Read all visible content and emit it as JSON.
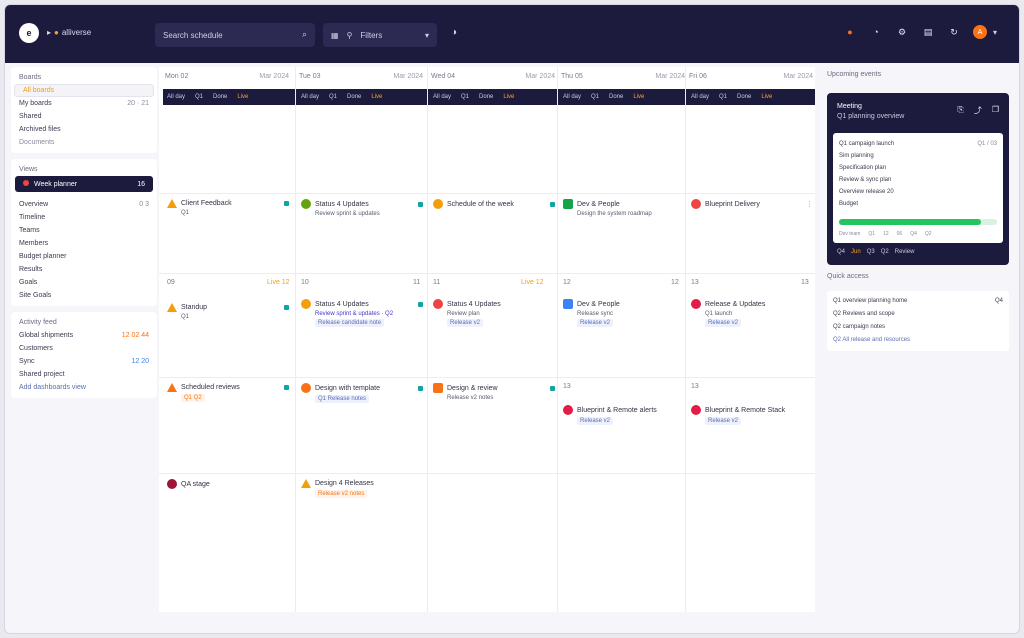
{
  "header": {
    "logo": "e",
    "brand": "alliverse",
    "search": {
      "text": "Search schedule"
    },
    "filter": {
      "label": "Filters"
    },
    "help_icon": "help-icon",
    "avatar": "A"
  },
  "sidebar": {
    "section1_title": "Boards",
    "items1": [
      {
        "label": "All boards",
        "count": ""
      },
      {
        "label": "My boards",
        "count": "20 · 21"
      },
      {
        "label": "Shared",
        "count": ""
      },
      {
        "label": "Archived files",
        "count": ""
      },
      {
        "label": "Documents",
        "count": ""
      }
    ],
    "section2_title": "Views",
    "active_item": {
      "label": "Week planner",
      "count": "16"
    },
    "items2": [
      {
        "label": "Overview",
        "count": "0 3"
      },
      {
        "label": "Timeline",
        "count": ""
      },
      {
        "label": "Teams",
        "count": ""
      },
      {
        "label": "Members",
        "count": ""
      },
      {
        "label": "Budget planner",
        "count": ""
      },
      {
        "label": "Results",
        "count": ""
      },
      {
        "label": "Goals",
        "count": ""
      },
      {
        "label": "Site Goals",
        "count": ""
      }
    ],
    "section3_title": "Activity feed",
    "items3": [
      {
        "label": "Global shipments",
        "count": "12 02 44"
      },
      {
        "label": "Customers",
        "count": ""
      },
      {
        "label": "Sync",
        "count": "12 20"
      },
      {
        "label": "Shared project",
        "count": ""
      },
      {
        "label": "Add dashboards view",
        "count": ""
      }
    ]
  },
  "calendar": {
    "columns": [
      {
        "title": "Mon 02",
        "sub": "Mar 2024"
      },
      {
        "title": "Tue 03",
        "sub": "Mar 2024"
      },
      {
        "title": "Wed 04",
        "sub": "Mar 2024"
      },
      {
        "title": "Thu 05",
        "sub": "Mar 2024"
      },
      {
        "title": "Fri 06",
        "sub": "Mar 2024"
      }
    ],
    "dark_bar": [
      {
        "a": "All day",
        "b": "Q1",
        "c": "Done",
        "d": "Live"
      },
      {
        "a": "All day",
        "b": "Q1",
        "c": "Done",
        "d": "Live"
      },
      {
        "a": "All day",
        "b": "Q1",
        "c": "Done",
        "d": "Live"
      },
      {
        "a": "All day",
        "b": "Q1",
        "c": "Done",
        "d": "Live"
      },
      {
        "a": "All day",
        "b": "Q1",
        "c": "Done",
        "d": "Live"
      }
    ],
    "day_numbers": [
      "09",
      "10",
      "11",
      "12",
      "13"
    ],
    "day_labels_right": [
      "Live 12",
      "11",
      "Live 12",
      "12",
      "13"
    ],
    "events": {
      "r1c1": {
        "title": "Client Feedback",
        "sub": "Q1"
      },
      "r1c2": {
        "title": "Status 4 Updates",
        "sub": "Review sprint & updates"
      },
      "r1c3": {
        "title": "Schedule of the week"
      },
      "r1c4": {
        "title": "Dev & People",
        "sub": "Design the system roadmap"
      },
      "r1c5": {
        "title": "Blueprint Delivery"
      },
      "r2c1": {
        "title": "Standup",
        "sub": "Q1"
      },
      "r2c2": {
        "title": "Status 4 Updates",
        "sub": "Review sprint & updates · Q2",
        "tag": "Release candidate note"
      },
      "r2c3": {
        "title": "Status 4 Updates",
        "sub": "Review plan",
        "tag": "Release v2"
      },
      "r2c4": {
        "title": "Dev & People",
        "sub": "Release sync",
        "tag": "Release v2"
      },
      "r2c5": {
        "title": "Release & Updates",
        "sub": "Q1 launch",
        "tag": "Release v2"
      },
      "r3c1": {
        "title": "Scheduled reviews",
        "tag": "Q1 Q2"
      },
      "r3c2": {
        "title": "Design with template",
        "tag": "Q1 Release notes"
      },
      "r3c3": {
        "title": "Design & review",
        "sub": "Release v2 notes"
      },
      "r3c4": {
        "title": "Blueprint & Remote alerts",
        "tag": "Release v2"
      },
      "r3c5": {
        "title": "Blueprint & Remote Stack",
        "tag": "Release v2"
      },
      "r4c1": {
        "title": "QA stage"
      },
      "r4c2": {
        "title": "Design 4 Releases",
        "tag": "Release v2 notes"
      }
    },
    "row3_days": [
      "",
      "",
      "",
      "13",
      "13"
    ]
  },
  "right": {
    "title": "Upcoming events",
    "feature": {
      "title": "Meeting",
      "sub": "Q1 planning overview",
      "lines": [
        "Q1 campaign launch",
        "Sim planning",
        "Specification plan",
        "Review & sync plan",
        "Overview release 20",
        "Budget"
      ],
      "meta": "Q1 / 03",
      "progress": 0.9,
      "card_footer": [
        "Dev team",
        "Q1",
        "12",
        "06",
        "Q4",
        "Q2"
      ],
      "footer": [
        "Q4",
        "Jun",
        "Q3",
        "Q2",
        "Review"
      ]
    },
    "section_title": "Quick access",
    "list": [
      {
        "label": "Q1 overview planning home",
        "count": "Q4"
      },
      {
        "label": "Q2 Reviews and scope",
        "count": ""
      },
      {
        "label": "Q2 campaign notes",
        "count": ""
      },
      {
        "label": "Q2 All release and resources",
        "count": ""
      }
    ]
  },
  "colors": {
    "navy": "#1d1b3d",
    "orange": "#f97316",
    "amber": "#f59e0b",
    "green": "#22c55e",
    "teal": "#0ea5a4",
    "red": "#ef4444",
    "blue": "#3b82f6"
  }
}
